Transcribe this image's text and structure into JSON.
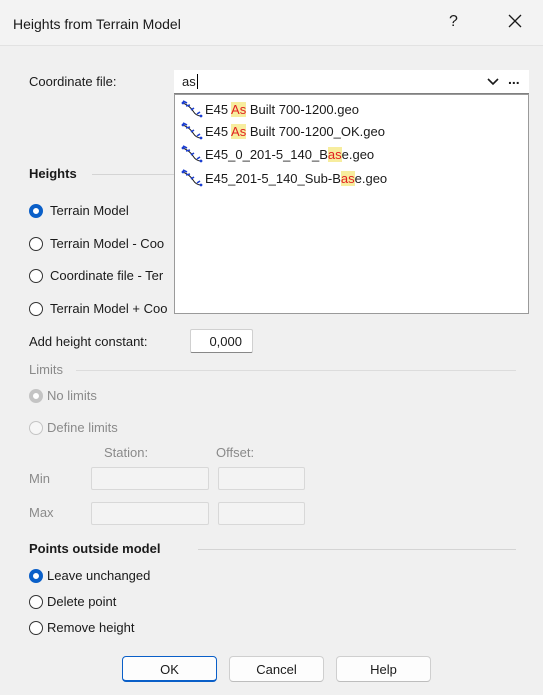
{
  "window": {
    "title": "Heights from Terrain Model",
    "help_glyph": "?"
  },
  "coordinate_file": {
    "label": "Coordinate file:",
    "value": "as",
    "browse_label": "...",
    "suggestions": [
      {
        "before": "E45 ",
        "match": "As",
        "after": " Built 700-1200.geo"
      },
      {
        "before": "E45 ",
        "match": "As",
        "after": " Built 700-1200_OK.geo"
      },
      {
        "before": "E45_0_201-5_140_B",
        "match": "as",
        "after": "e.geo"
      },
      {
        "before": "E45_201-5_140_Sub-B",
        "match": "as",
        "after": "e.geo"
      }
    ]
  },
  "heights": {
    "heading": "Heights",
    "options": [
      {
        "label": "Terrain Model",
        "checked": true
      },
      {
        "label": "Terrain Model - Coo",
        "checked": false
      },
      {
        "label": "Coordinate file - Ter",
        "checked": false
      },
      {
        "label": "Terrain Model + Coo",
        "checked": false
      }
    ],
    "constant_label": "Add height constant:",
    "constant_value": "0,000"
  },
  "limits": {
    "heading": "Limits",
    "no_limits": "No limits",
    "define_limits": "Define limits",
    "station_label": "Station:",
    "offset_label": "Offset:",
    "min_label": "Min",
    "max_label": "Max"
  },
  "outside": {
    "heading": "Points outside model",
    "options": [
      {
        "label": "Leave unchanged",
        "checked": true
      },
      {
        "label": "Delete point",
        "checked": false
      },
      {
        "label": "Remove height",
        "checked": false
      }
    ]
  },
  "buttons": {
    "ok": "OK",
    "cancel": "Cancel",
    "help": "Help"
  },
  "colors": {
    "accent": "#0a5fc8",
    "match_highlight": "#f7ed9e",
    "match_text": "#e02020"
  }
}
